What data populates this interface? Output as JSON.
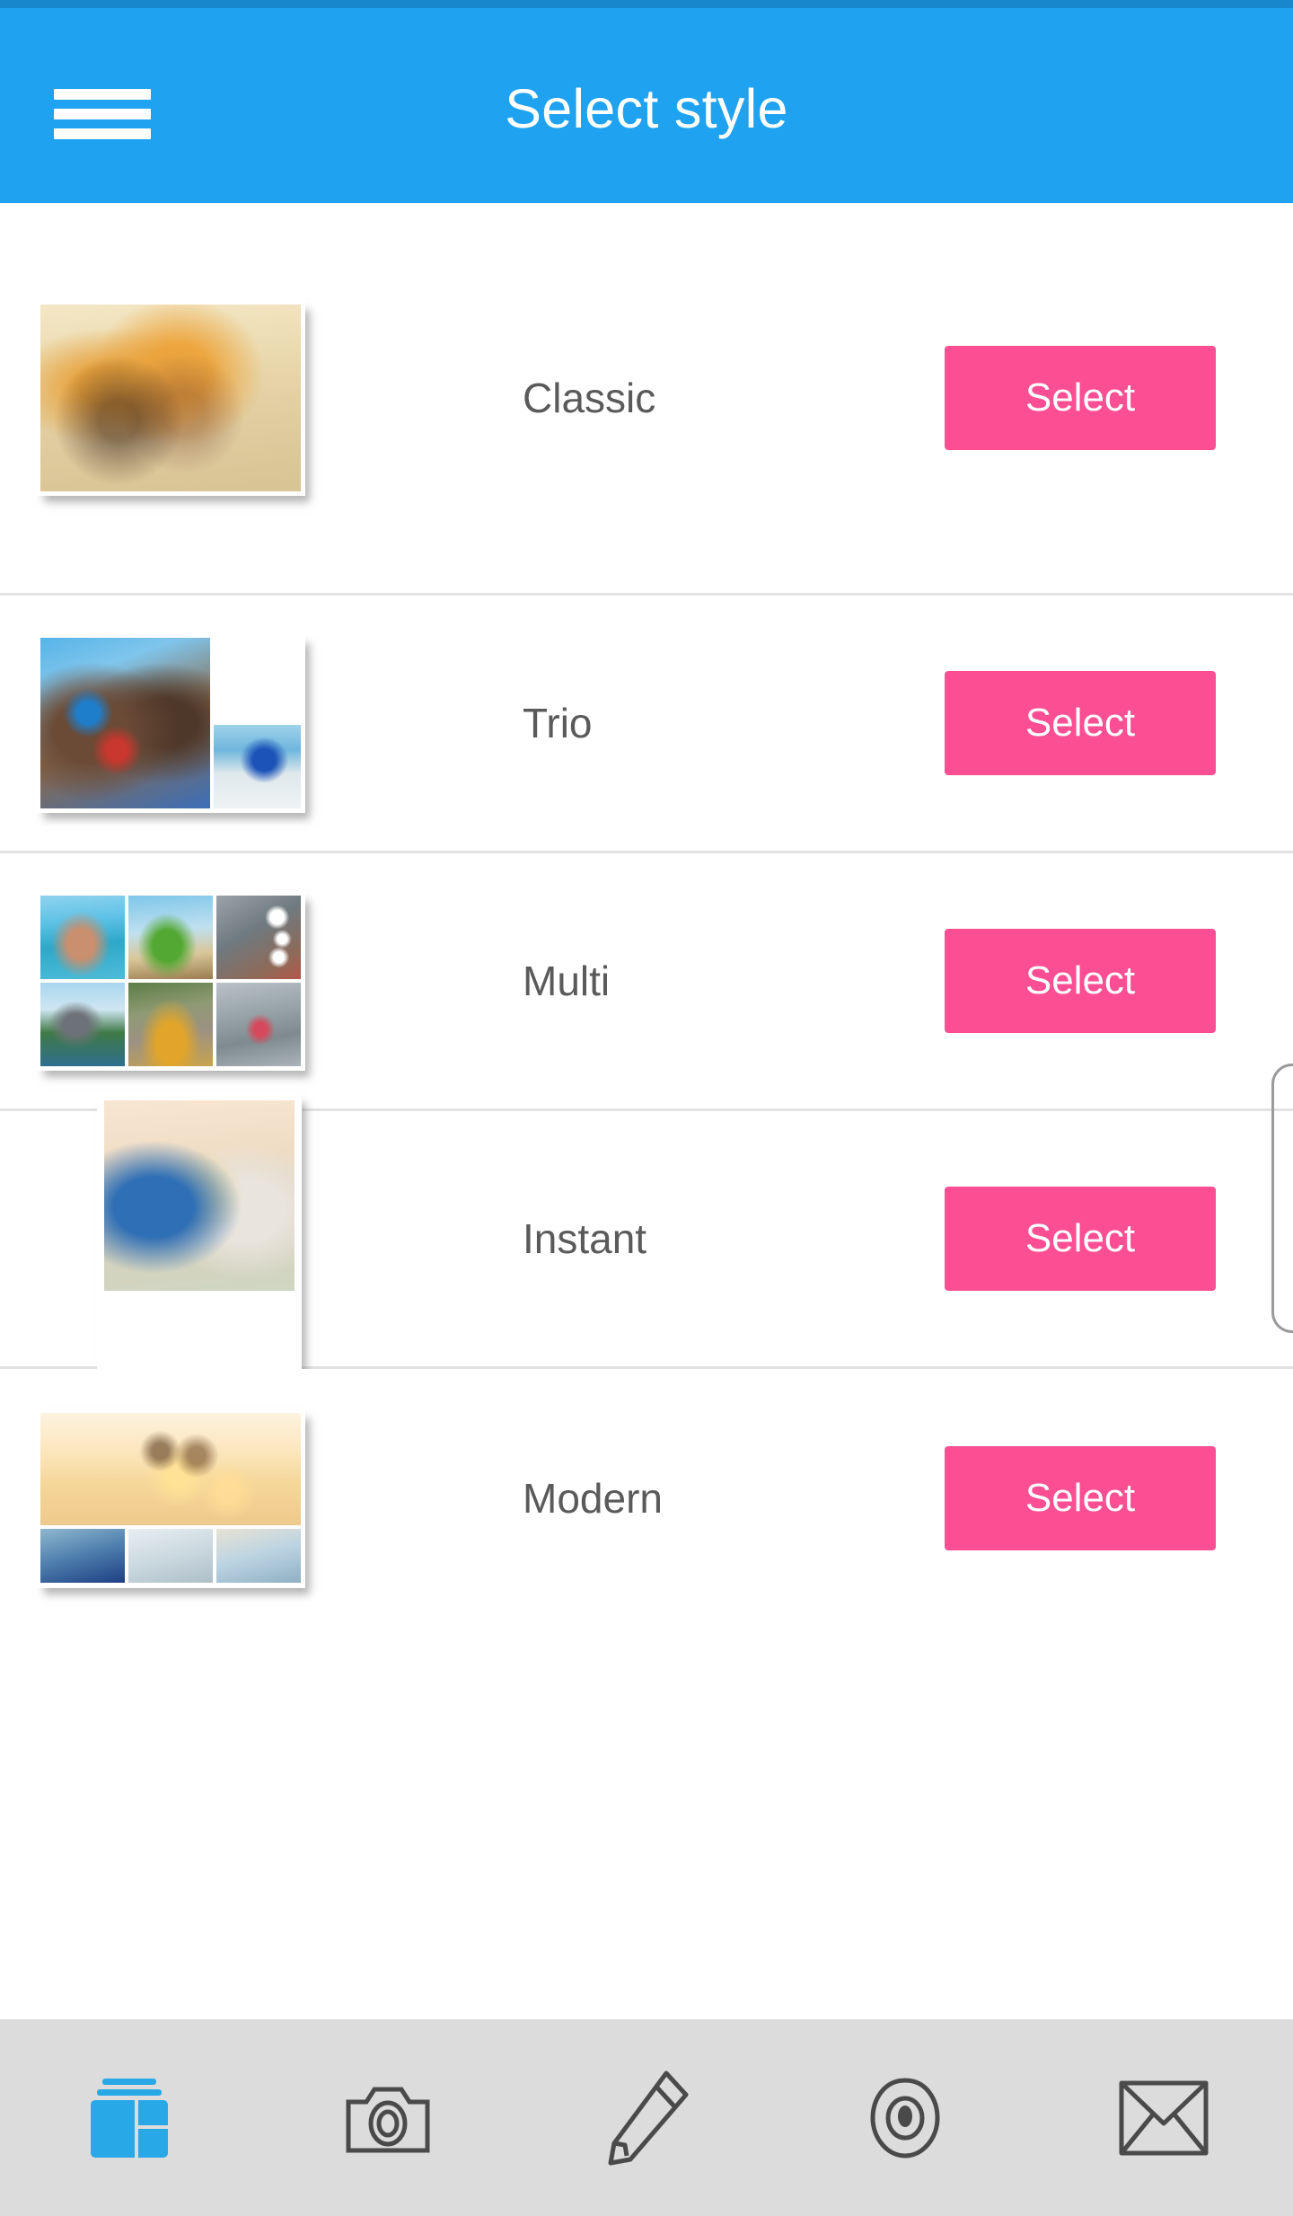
{
  "app": {
    "header": {
      "title": "Select style",
      "menu_icon": "hamburger-menu-icon",
      "background_color": "#1fa2f0",
      "statusbar_color": "#1887cc",
      "title_color": "#ffffff"
    },
    "accent_color": "#fc4e93",
    "label_color": "#5a5a5a",
    "toolbar_background": "#dcdcdc",
    "divider_color": "#e2e2e2"
  },
  "styles": [
    {
      "name": "Classic",
      "select_label": "Select",
      "layout": "single"
    },
    {
      "name": "Trio",
      "select_label": "Select",
      "layout": "one-large-two-stacked"
    },
    {
      "name": "Multi",
      "select_label": "Select",
      "layout": "grid-3x2"
    },
    {
      "name": "Instant",
      "select_label": "Select",
      "layout": "polaroid"
    },
    {
      "name": "Modern",
      "select_label": "Select",
      "layout": "wide-plus-strip"
    }
  ],
  "toolbar": {
    "items": [
      {
        "icon": "collage-layout-icon",
        "active": true,
        "color": "#29a8e8"
      },
      {
        "icon": "camera-icon",
        "active": false,
        "color": "#4a4a4a"
      },
      {
        "icon": "pencil-icon",
        "active": false,
        "color": "#4a4a4a"
      },
      {
        "icon": "eye-icon",
        "active": false,
        "color": "#4a4a4a"
      },
      {
        "icon": "envelope-icon",
        "active": false,
        "color": "#4a4a4a"
      }
    ]
  },
  "scrollbar": {
    "visible": true,
    "color": "#9a9a9a"
  }
}
